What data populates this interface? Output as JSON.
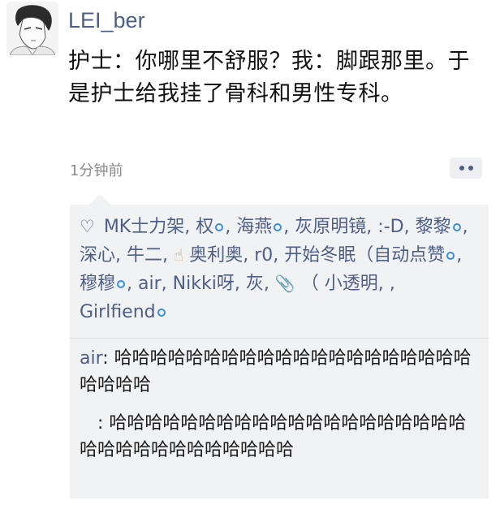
{
  "post": {
    "username": "LEI_ber",
    "text": "护士：你哪里不舒服？我：脚跟那里。于是护士给我挂了骨科和男性专科。",
    "time": "1分钟前"
  },
  "likes": {
    "names": [
      "MK士力架",
      "权",
      "海燕",
      "灰原明镜",
      ":-D",
      "黎黎",
      "深心",
      "牛二",
      "奥利奥",
      "r0",
      "开始冬眠（自动点赞",
      "穆穆",
      "air",
      "Nikki呀",
      "灰",
      "（ 小透明",
      "Girlfiend"
    ]
  },
  "comments": [
    {
      "author": "air",
      "sep": ": ",
      "text": "哈哈哈哈哈哈哈哈哈哈哈哈哈哈哈哈哈哈哈哈哈哈哈哈"
    },
    {
      "author": "",
      "sep": ": ",
      "text": "哈哈哈哈哈哈哈哈哈哈哈哈哈哈哈哈哈哈哈哈哈哈哈哈哈哈哈哈哈哈哈哈"
    }
  ]
}
